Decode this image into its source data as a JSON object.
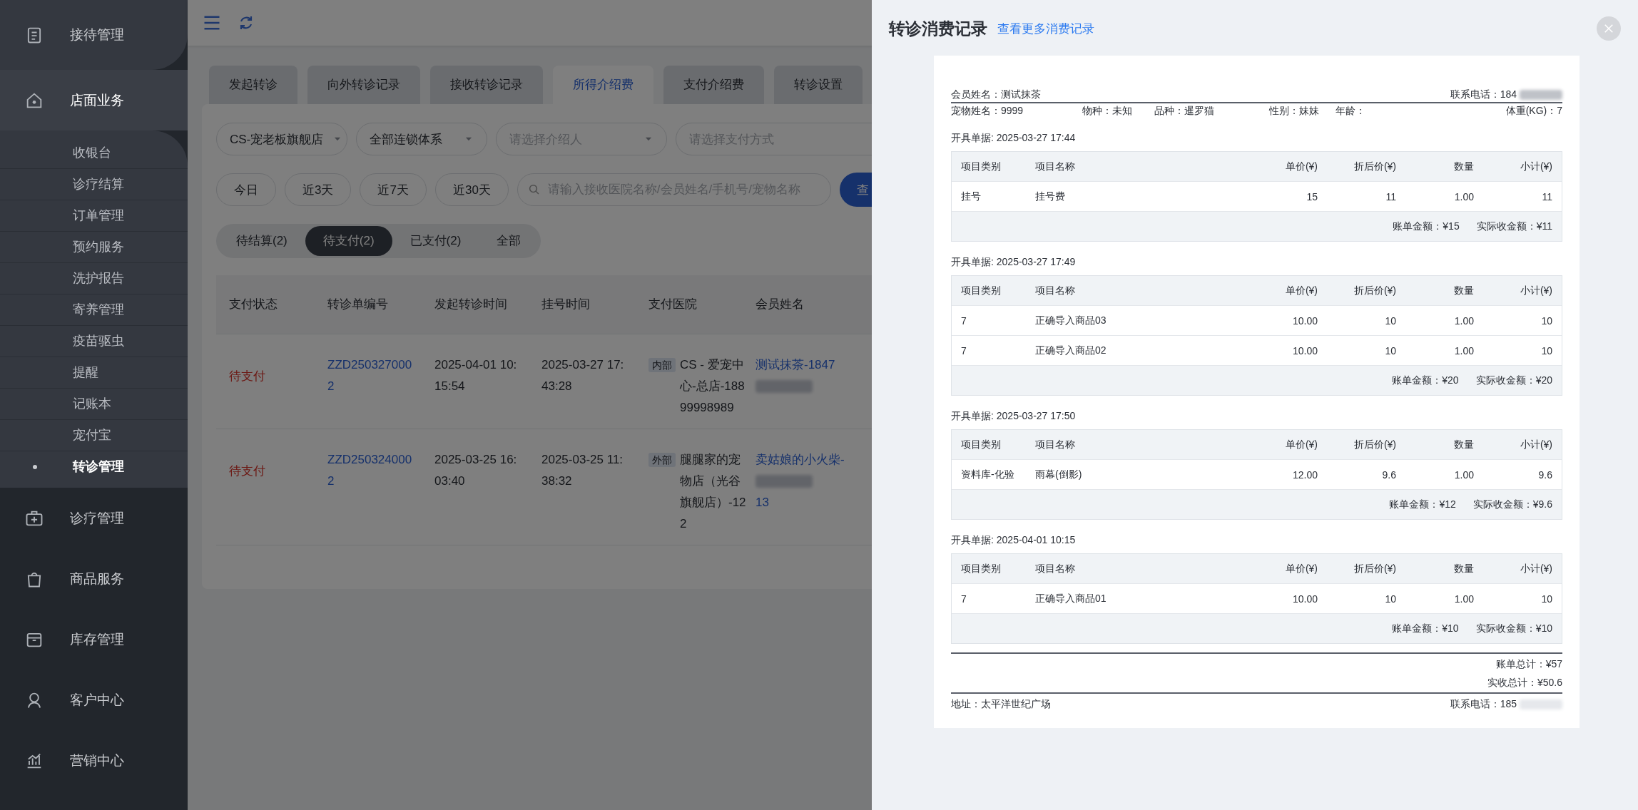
{
  "sidebar": {
    "items": [
      {
        "label": "接待管理",
        "expanded": false
      },
      {
        "label": "店面业务",
        "expanded": true,
        "children": [
          {
            "label": "收银台",
            "selected": false
          },
          {
            "label": "诊疗结算",
            "selected": false
          },
          {
            "label": "订单管理",
            "selected": false
          },
          {
            "label": "预约服务",
            "selected": false
          },
          {
            "label": "洗护报告",
            "selected": false
          },
          {
            "label": "寄养管理",
            "selected": false
          },
          {
            "label": "疫苗驱虫",
            "selected": false
          },
          {
            "label": "提醒",
            "selected": false
          },
          {
            "label": "记账本",
            "selected": false
          },
          {
            "label": "宠付宝",
            "selected": false
          },
          {
            "label": "转诊管理",
            "selected": true
          }
        ]
      },
      {
        "label": "诊疗管理",
        "expanded": false
      },
      {
        "label": "商品服务",
        "expanded": false
      },
      {
        "label": "库存管理",
        "expanded": false
      },
      {
        "label": "客户中心",
        "expanded": false
      },
      {
        "label": "营销中心",
        "expanded": false
      }
    ]
  },
  "tabs": [
    {
      "label": "发起转诊",
      "selected": false
    },
    {
      "label": "向外转诊记录",
      "selected": false
    },
    {
      "label": "接收转诊记录",
      "selected": false
    },
    {
      "label": "所得介绍费",
      "selected": true
    },
    {
      "label": "支付介绍费",
      "selected": false
    },
    {
      "label": "转诊设置",
      "selected": false
    }
  ],
  "filters": {
    "selects": [
      {
        "value": "CS-宠老板旗舰店"
      },
      {
        "value": "全部连锁体系"
      },
      {
        "placeholder": "请选择介绍人"
      },
      {
        "placeholder": "请选择支付方式"
      }
    ],
    "date_buttons": [
      "今日",
      "近3天",
      "近7天",
      "近30天"
    ],
    "search": {
      "placeholder": "请输入接收医院名称/会员姓名/手机号/宠物名称"
    },
    "search_button": "查"
  },
  "status_tabs": [
    {
      "label": "待结算(2)",
      "selected": false
    },
    {
      "label": "待支付(2)",
      "selected": true
    },
    {
      "label": "已支付(2)",
      "selected": false
    },
    {
      "label": "全部",
      "selected": false
    }
  ],
  "table": {
    "columns": [
      "支付状态",
      "转诊单编号",
      "发起转诊时间",
      "挂号时间",
      "支付医院",
      "会员姓名"
    ],
    "rows": [
      {
        "status": "待支付",
        "order_no": "ZZD2503270002",
        "start_time": "2025-04-01 10:15:54",
        "reg_time": "2025-03-27 17:43:28",
        "hospital_tag": "内部",
        "hospital": "CS - 爱宠中心-总店-18899998989",
        "member": "测试抹茶-1847"
      },
      {
        "status": "待支付",
        "order_no": "ZZD2503240002",
        "start_time": "2025-03-25 16:03:40",
        "reg_time": "2025-03-25 11:38:32",
        "hospital_tag": "外部",
        "hospital": "腿腿家的宠物店（光谷旗舰店）-122",
        "member": "卖姑娘的小火柴-",
        "member_suffix": "13"
      }
    ]
  },
  "drawer": {
    "title": "转诊消费记录",
    "link": "查看更多消费记录",
    "member": "会员姓名：测试抹茶",
    "phone": "联系电话：184",
    "pet_fields": [
      "宠物姓名：9999",
      "物种：未知",
      "品种：暹罗猫",
      "性别：妹妹",
      "年龄：",
      "体重(KG)：7"
    ],
    "bills": [
      {
        "issued": "开具单据: 2025-03-27 17:44",
        "columns": [
          "项目类别",
          "项目名称",
          "单价(¥)",
          "折后价(¥)",
          "数量",
          "小计(¥)"
        ],
        "rows": [
          [
            "挂号",
            "挂号费",
            "15",
            "11",
            "1.00",
            "11"
          ]
        ],
        "bill_amount": "账单金额：¥15",
        "actual_amount": "实际收金额：¥11"
      },
      {
        "issued": "开具单据: 2025-03-27 17:49",
        "columns": [
          "项目类别",
          "项目名称",
          "单价(¥)",
          "折后价(¥)",
          "数量",
          "小计(¥)"
        ],
        "rows": [
          [
            "7",
            "正确导入商品03",
            "10.00",
            "10",
            "1.00",
            "10"
          ],
          [
            "7",
            "正确导入商品02",
            "10.00",
            "10",
            "1.00",
            "10"
          ]
        ],
        "bill_amount": "账单金额：¥20",
        "actual_amount": "实际收金额：¥20"
      },
      {
        "issued": "开具单据: 2025-03-27 17:50",
        "columns": [
          "项目类别",
          "项目名称",
          "单价(¥)",
          "折后价(¥)",
          "数量",
          "小计(¥)"
        ],
        "rows": [
          [
            "资料库-化验",
            "雨幕(倒影)",
            "12.00",
            "9.6",
            "1.00",
            "9.6"
          ]
        ],
        "bill_amount": "账单金额：¥12",
        "actual_amount": "实际收金额：¥9.6"
      },
      {
        "issued": "开具单据: 2025-04-01 10:15",
        "columns": [
          "项目类别",
          "项目名称",
          "单价(¥)",
          "折后价(¥)",
          "数量",
          "小计(¥)"
        ],
        "rows": [
          [
            "7",
            "正确导入商品01",
            "10.00",
            "10",
            "1.00",
            "10"
          ]
        ],
        "bill_amount": "账单金额：¥10",
        "actual_amount": "实际收金额：¥10"
      }
    ],
    "total_bill": "账单总计：¥57",
    "total_actual": "实收总计：¥50.6",
    "address": "地址：太平洋世纪广场",
    "contact": "联系电话：185"
  }
}
